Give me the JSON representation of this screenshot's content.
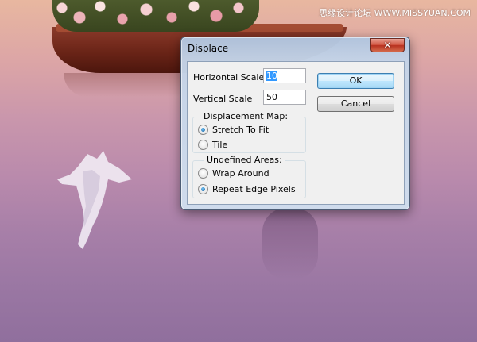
{
  "watermark": {
    "text": "思缘设计论坛 WWW.MISSYUAN.COM"
  },
  "dialog": {
    "title": "Displace",
    "close_symbol": "✕",
    "horizontal_scale": {
      "label": "Horizontal Scale",
      "value": "10"
    },
    "vertical_scale": {
      "label": "Vertical Scale",
      "value": "50"
    },
    "ok_label": "OK",
    "cancel_label": "Cancel",
    "displacement_map": {
      "title": "Displacement Map:",
      "options": [
        {
          "label": "Stretch To Fit",
          "checked": true
        },
        {
          "label": "Tile",
          "checked": false
        }
      ]
    },
    "undefined_areas": {
      "title": "Undefined Areas:",
      "options": [
        {
          "label": "Wrap Around",
          "checked": false
        },
        {
          "label": "Repeat Edge Pixels",
          "checked": true
        }
      ]
    }
  },
  "colors": {
    "close_button": "#c8442f",
    "default_button_border": "#3c7fb1",
    "selection": "#3399ff"
  }
}
